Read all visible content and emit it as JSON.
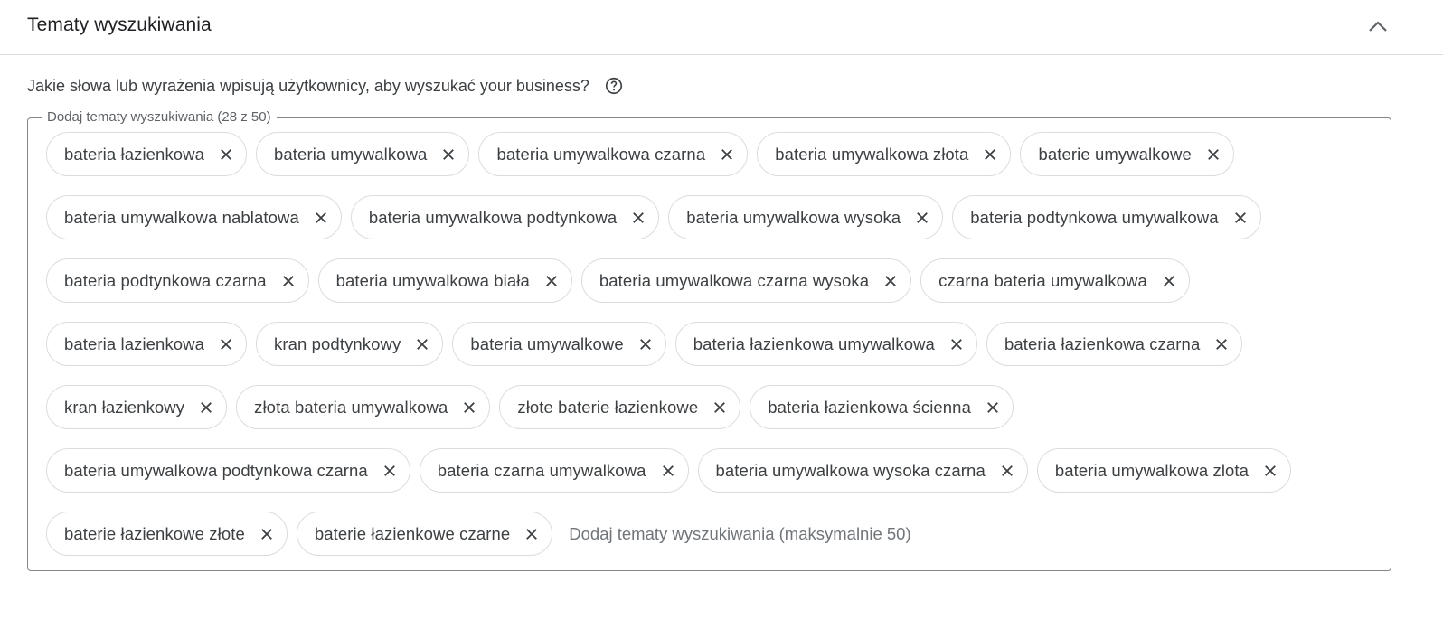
{
  "section": {
    "title": "Tematy wyszukiwania",
    "question": "Jakie słowa lub wyrażenia wpisują użytkownicy, aby wyszukać your business?",
    "legend": "Dodaj tematy wyszukiwania (28 z 50)",
    "input_placeholder": "Dodaj tematy wyszukiwania (maksymalnie 50)",
    "topics": [
      "bateria łazienkowa",
      "bateria umywalkowa",
      "bateria umywalkowa czarna",
      "bateria umywalkowa złota",
      "baterie umywalkowe",
      "bateria umywalkowa nablatowa",
      "bateria umywalkowa podtynkowa",
      "bateria umywalkowa wysoka",
      "bateria podtynkowa umywalkowa",
      "bateria podtynkowa czarna",
      "bateria umywalkowa biała",
      "bateria umywalkowa czarna wysoka",
      "czarna bateria umywalkowa",
      "bateria lazienkowa",
      "kran podtynkowy",
      "bateria umywalkowe",
      "bateria łazienkowa umywalkowa",
      "bateria łazienkowa czarna",
      "kran łazienkowy",
      "złota bateria umywalkowa",
      "złote baterie łazienkowe",
      "bateria łazienkowa ścienna",
      "bateria umywalkowa podtynkowa czarna",
      "bateria czarna umywalkowa",
      "bateria umywalkowa wysoka czarna",
      "bateria umywalkowa zlota",
      "baterie łazienkowe złote",
      "baterie łazienkowe czarne"
    ]
  },
  "icons": {
    "collapse": "chevron-up-icon",
    "help": "help-circle-icon",
    "remove": "close-icon"
  },
  "colors": {
    "text": "#202124",
    "secondary_text": "#5f6368",
    "border": "#dadce0",
    "field_border": "#80868b"
  }
}
